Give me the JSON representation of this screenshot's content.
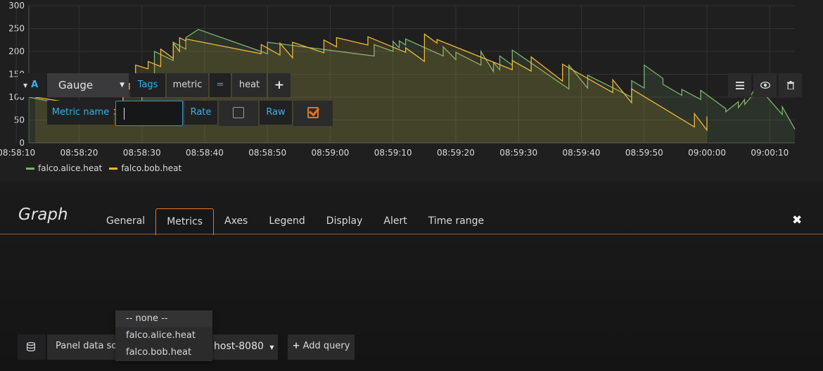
{
  "chart_data": {
    "type": "area",
    "xlim": [
      "08:58:12",
      "09:00:14"
    ],
    "ylim": [
      0,
      300
    ],
    "yticks": [
      0,
      50,
      100,
      150,
      200,
      250,
      300
    ],
    "xticks": [
      "08:58:10",
      "08:58:20",
      "08:58:30",
      "08:58:40",
      "08:58:50",
      "08:59:00",
      "08:59:10",
      "08:59:20",
      "08:59:30",
      "08:59:40",
      "08:59:50",
      "09:00:00",
      "09:00:10"
    ],
    "grid": true,
    "legend": "bottom-left",
    "series": [
      {
        "name": "falco.alice.heat",
        "color": "#7eb26d",
        "x": [
          "08:58:12",
          "08:58:28",
          "08:58:28",
          "08:58:30",
          "08:58:30",
          "08:58:31",
          "08:58:31",
          "08:58:32",
          "08:58:32",
          "08:58:35",
          "08:58:35",
          "08:58:37",
          "08:58:37",
          "08:58:39",
          "08:58:50",
          "08:58:50",
          "08:59:07",
          "08:59:07",
          "08:59:10",
          "08:59:10",
          "08:59:11",
          "08:59:11",
          "08:59:12",
          "08:59:12",
          "08:59:18",
          "08:59:18",
          "08:59:20",
          "08:59:20",
          "08:59:24",
          "08:59:24",
          "08:59:26",
          "08:59:26",
          "08:59:27",
          "08:59:27",
          "08:59:29",
          "08:59:29",
          "08:59:38",
          "08:59:38",
          "08:59:41",
          "08:59:41",
          "08:59:48",
          "08:59:48",
          "08:59:50",
          "08:59:50",
          "08:59:53",
          "08:59:53",
          "08:59:56",
          "08:59:56",
          "08:59:59",
          "08:59:59",
          "09:00:03",
          "09:00:03",
          "09:00:05",
          "09:00:05",
          "09:00:06",
          "09:00:06",
          "09:00:07",
          "09:00:07",
          "09:00:08",
          "09:00:08",
          "09:00:12",
          "09:00:12",
          "09:00:14"
        ],
        "values": [
          100,
          57,
          80,
          72,
          120,
          114,
          150,
          140,
          200,
          180,
          220,
          205,
          230,
          248,
          195,
          220,
          190,
          215,
          200,
          222,
          208,
          223,
          214,
          227,
          190,
          210,
          182,
          198,
          170,
          200,
          156,
          176,
          160,
          190,
          170,
          203,
          118,
          170,
          120,
          148,
          100,
          136,
          120,
          170,
          141,
          128,
          104,
          117,
          95,
          115,
          75,
          68,
          90,
          77,
          95,
          84,
          100,
          104,
          126,
          125,
          62,
          79,
          30
        ]
      },
      {
        "name": "falco.bob.heat",
        "color": "#eab839",
        "x": [
          "08:58:13",
          "08:58:27",
          "08:58:27",
          "08:58:28",
          "08:58:28",
          "08:58:29",
          "08:58:29",
          "08:58:31",
          "08:58:31",
          "08:58:33",
          "08:58:33",
          "08:58:35",
          "08:58:35",
          "08:58:36",
          "08:58:36",
          "08:58:37",
          "08:58:37",
          "08:58:49",
          "08:58:49",
          "08:58:52",
          "08:58:52",
          "08:58:54",
          "08:58:54",
          "08:58:59",
          "08:58:59",
          "08:59:01",
          "08:59:01",
          "08:59:06",
          "08:59:06",
          "08:59:12",
          "08:59:12",
          "08:59:15",
          "08:59:15",
          "08:59:17",
          "08:59:17",
          "08:59:29",
          "08:59:29",
          "08:59:32",
          "08:59:32",
          "08:59:37",
          "08:59:37",
          "08:59:45",
          "08:59:45",
          "08:59:48",
          "08:59:48",
          "08:59:58",
          "08:59:58",
          "09:00:00",
          "09:00:00",
          "09:00:00"
        ],
        "values": [
          100,
          70,
          121,
          118,
          130,
          125,
          170,
          162,
          178,
          167,
          205,
          185,
          218,
          200,
          230,
          223,
          227,
          195,
          215,
          192,
          218,
          186,
          220,
          197,
          225,
          210,
          230,
          214,
          232,
          198,
          208,
          178,
          238,
          218,
          226,
          160,
          180,
          157,
          188,
          135,
          172,
          110,
          138,
          88,
          118,
          35,
          64,
          28,
          58,
          55
        ]
      }
    ]
  },
  "editor": {
    "title": "Graph",
    "tabs": [
      {
        "label": "General",
        "active": false
      },
      {
        "label": "Metrics",
        "active": true
      },
      {
        "label": "Axes",
        "active": false
      },
      {
        "label": "Legend",
        "active": false
      },
      {
        "label": "Display",
        "active": false
      },
      {
        "label": "Alert",
        "active": false
      },
      {
        "label": "Time range",
        "active": false
      }
    ],
    "close": "✖"
  },
  "query": {
    "ref_id": "A",
    "aggregator": "Gauge",
    "tags_label": "Tags",
    "tag_key": "metric",
    "tag_op": "=",
    "tag_value": "heat",
    "add_tag": "+",
    "metric_name_label": "Metric name",
    "metric_name_value": "",
    "rate_label": "Rate",
    "rate_checked": false,
    "raw_label": "Raw",
    "raw_checked": true,
    "suggestions": [
      "-- none --",
      "falco.alice.heat",
      "falco.bob.heat"
    ]
  },
  "datasource": {
    "label": "Panel data sour",
    "value": "host-8080",
    "add_query": "Add query"
  },
  "colors": {
    "accent": "#e8751a",
    "link": "#33b5e5",
    "alice": "#7eb26d",
    "bob": "#eab839"
  }
}
